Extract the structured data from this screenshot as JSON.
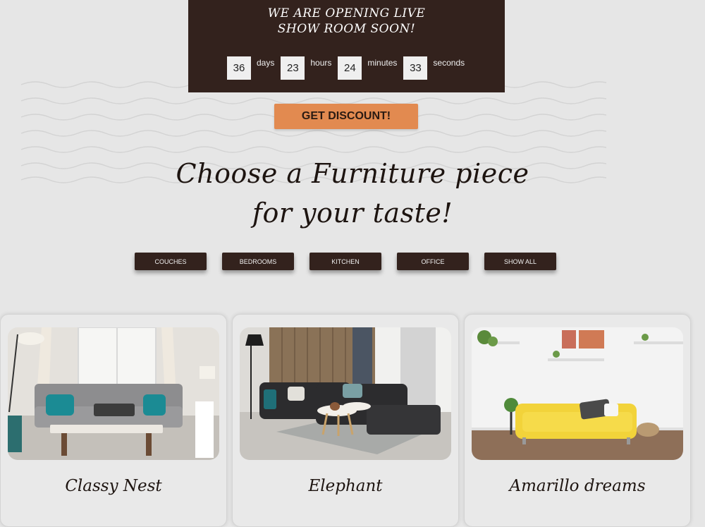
{
  "banner": {
    "line1": "We are opening live",
    "line2": "show room soon!",
    "countdown": [
      {
        "value": "36",
        "unit": "days"
      },
      {
        "value": "23",
        "unit": "hours"
      },
      {
        "value": "24",
        "unit": "minutes"
      },
      {
        "value": "33",
        "unit": "seconds"
      }
    ]
  },
  "discount_label": "GET DISCOUNT!",
  "headline": {
    "line1": "Choose a Furniture piece",
    "line2": "for your taste!"
  },
  "categories": [
    "Couches",
    "Bedrooms",
    "Kitchen",
    "Office",
    "Show all"
  ],
  "products": [
    {
      "title": "Classy Nest"
    },
    {
      "title": "Elephant"
    },
    {
      "title": "Amarillo dreams"
    }
  ],
  "colors": {
    "banner": "#33221d",
    "accent": "#e28a50",
    "background": "#e6e6e6"
  }
}
